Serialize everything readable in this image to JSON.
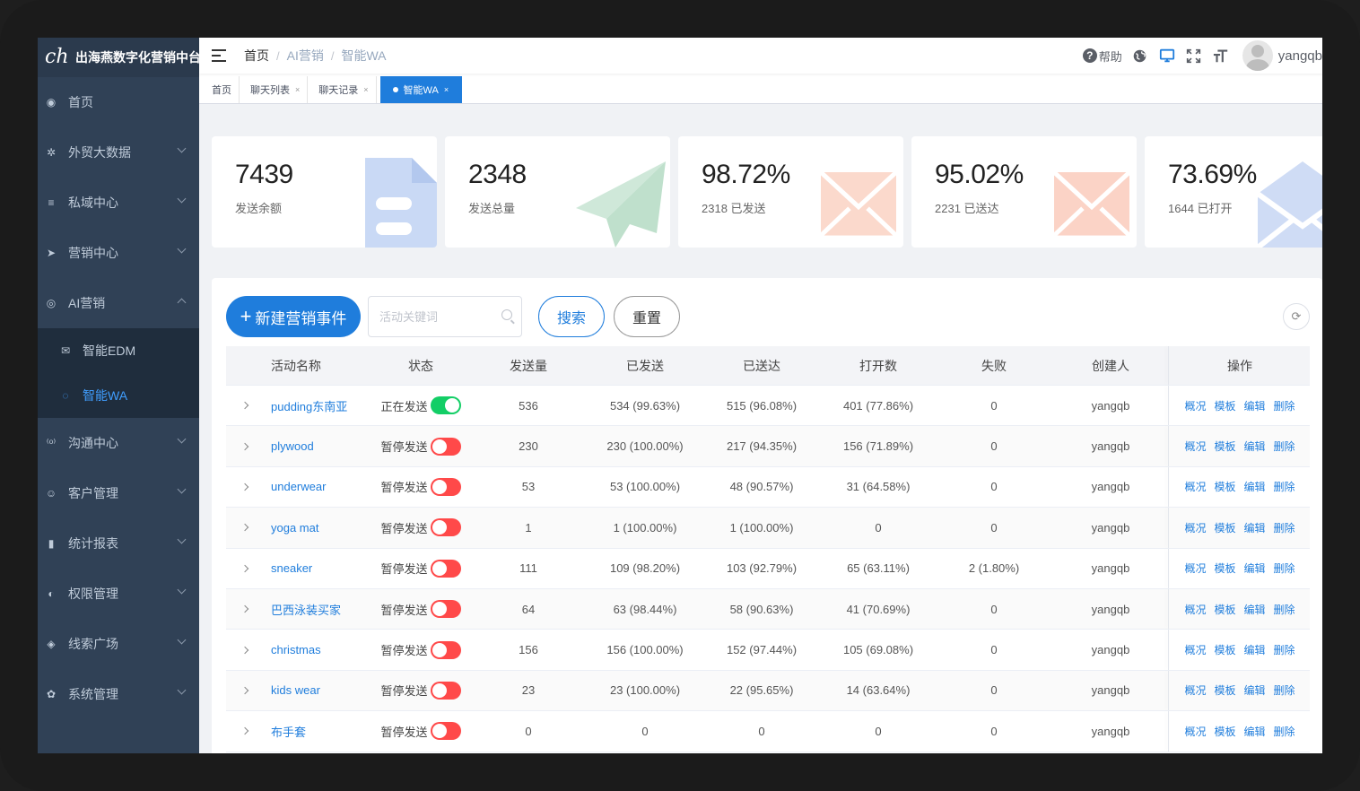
{
  "app": {
    "logo_mark": "ch",
    "title": "出海燕数字化营销中台"
  },
  "sidebar": {
    "items": [
      {
        "label": "首页",
        "icon": "dashboard-icon",
        "glyph": "◉"
      },
      {
        "label": "外贸大数据",
        "icon": "gear-icon",
        "glyph": "✲"
      },
      {
        "label": "私域中心",
        "icon": "list-icon",
        "glyph": "≡"
      },
      {
        "label": "营销中心",
        "icon": "send-icon",
        "glyph": "➤"
      },
      {
        "label": "AI营销",
        "icon": "ai-icon",
        "glyph": "◎"
      }
    ],
    "sub_items": [
      {
        "label": "智能EDM",
        "icon": "mail-icon",
        "glyph": "✉"
      },
      {
        "label": "智能WA",
        "icon": "whatsapp-icon",
        "glyph": "◌"
      }
    ],
    "items_after": [
      {
        "label": "沟通中心",
        "icon": "chat-icon",
        "glyph": "⁽ᵒ⁾"
      },
      {
        "label": "客户管理",
        "icon": "customer-icon",
        "glyph": "☺"
      },
      {
        "label": "统计报表",
        "icon": "chart-icon",
        "glyph": "▮"
      },
      {
        "label": "权限管理",
        "icon": "globe-icon",
        "glyph": "◐"
      },
      {
        "label": "线索广场",
        "icon": "lead-icon",
        "glyph": "◈"
      },
      {
        "label": "系统管理",
        "icon": "settings-icon",
        "glyph": "✿"
      }
    ]
  },
  "navbar": {
    "breadcrumb": [
      "首页",
      "AI营销",
      "智能WA"
    ],
    "help_label": "帮助",
    "username": "yangqb"
  },
  "tags": [
    {
      "label": "首页",
      "closable": false,
      "active": false
    },
    {
      "label": "聊天列表",
      "closable": true,
      "active": false
    },
    {
      "label": "聊天记录",
      "closable": true,
      "active": false
    },
    {
      "label": "智能WA",
      "closable": true,
      "active": true
    }
  ],
  "stats": [
    {
      "value": "7439",
      "label": "发送余额",
      "icon": "document-icon",
      "color": "#c9d9f5"
    },
    {
      "value": "2348",
      "label": "发送总量",
      "icon": "paper-plane-icon",
      "color": "#cfe8d9"
    },
    {
      "value": "98.72%",
      "label": "2318 已发送",
      "icon": "envelope-icon",
      "color": "#fbd9cc"
    },
    {
      "value": "95.02%",
      "label": "2231 已送达",
      "icon": "envelope-icon",
      "color": "#fbd3c6"
    },
    {
      "value": "73.69%",
      "label": "1644 已打开",
      "icon": "envelope-icon",
      "color": "#cfdcf5"
    }
  ],
  "toolbar": {
    "new_label": "新建营销事件",
    "search_placeholder": "活动关键词",
    "search_label": "搜索",
    "reset_label": "重置"
  },
  "table": {
    "headers": [
      "活动名称",
      "状态",
      "发送量",
      "已发送",
      "已送达",
      "打开数",
      "失败",
      "创建人",
      "操作"
    ],
    "ops": [
      "概况",
      "模板",
      "编辑",
      "删除"
    ],
    "rows": [
      {
        "name": "pudding东南亚",
        "status": "正在发送",
        "on": true,
        "count": "536",
        "sent": "534 (99.63%)",
        "delivered": "515 (96.08%)",
        "opened": "401 (77.86%)",
        "failed": "0",
        "creator": "yangqb"
      },
      {
        "name": "plywood",
        "status": "暂停发送",
        "on": false,
        "count": "230",
        "sent": "230 (100.00%)",
        "delivered": "217 (94.35%)",
        "opened": "156 (71.89%)",
        "failed": "0",
        "creator": "yangqb"
      },
      {
        "name": "underwear",
        "status": "暂停发送",
        "on": false,
        "count": "53",
        "sent": "53 (100.00%)",
        "delivered": "48 (90.57%)",
        "opened": "31 (64.58%)",
        "failed": "0",
        "creator": "yangqb"
      },
      {
        "name": "yoga mat",
        "status": "暂停发送",
        "on": false,
        "count": "1",
        "sent": "1 (100.00%)",
        "delivered": "1 (100.00%)",
        "opened": "0",
        "failed": "0",
        "creator": "yangqb"
      },
      {
        "name": "sneaker",
        "status": "暂停发送",
        "on": false,
        "count": "111",
        "sent": "109 (98.20%)",
        "delivered": "103 (92.79%)",
        "opened": "65 (63.11%)",
        "failed": "2 (1.80%)",
        "creator": "yangqb"
      },
      {
        "name": "巴西泳装买家",
        "status": "暂停发送",
        "on": false,
        "count": "64",
        "sent": "63 (98.44%)",
        "delivered": "58 (90.63%)",
        "opened": "41 (70.69%)",
        "failed": "0",
        "creator": "yangqb"
      },
      {
        "name": "christmas",
        "status": "暂停发送",
        "on": false,
        "count": "156",
        "sent": "156 (100.00%)",
        "delivered": "152 (97.44%)",
        "opened": "105 (69.08%)",
        "failed": "0",
        "creator": "yangqb"
      },
      {
        "name": "kids wear",
        "status": "暂停发送",
        "on": false,
        "count": "23",
        "sent": "23 (100.00%)",
        "delivered": "22 (95.65%)",
        "opened": "14 (63.64%)",
        "failed": "0",
        "creator": "yangqb"
      },
      {
        "name": "布手套",
        "status": "暂停发送",
        "on": false,
        "count": "0",
        "sent": "0",
        "delivered": "0",
        "opened": "0",
        "failed": "0",
        "creator": "yangqb"
      }
    ]
  }
}
